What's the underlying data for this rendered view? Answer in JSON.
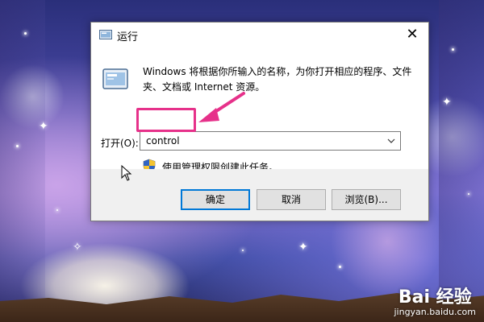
{
  "dialog": {
    "title": "运行",
    "description": "Windows 将根据你所输入的名称，为你打开相应的程序、文件夹、文档或 Internet 资源。",
    "open_label": "打开(O):",
    "open_value": "control",
    "admin_note": "使用管理权限创建此任务。",
    "buttons": {
      "ok": "确定",
      "cancel": "取消",
      "browse": "浏览(B)..."
    },
    "close_glyph": "✕",
    "icons": [
      "run-app-icon",
      "shield-uac-icon",
      "chevron-down-icon",
      "close-icon"
    ]
  },
  "annotation": {
    "highlight_color": "#e6318a",
    "target": "open-input"
  },
  "watermark": {
    "logo": "Bai 经验",
    "url": "jingyan.baidu.com"
  },
  "colors": {
    "accent": "#0078d7",
    "annotation": "#e6318a",
    "footer": "#f0f0f0"
  }
}
